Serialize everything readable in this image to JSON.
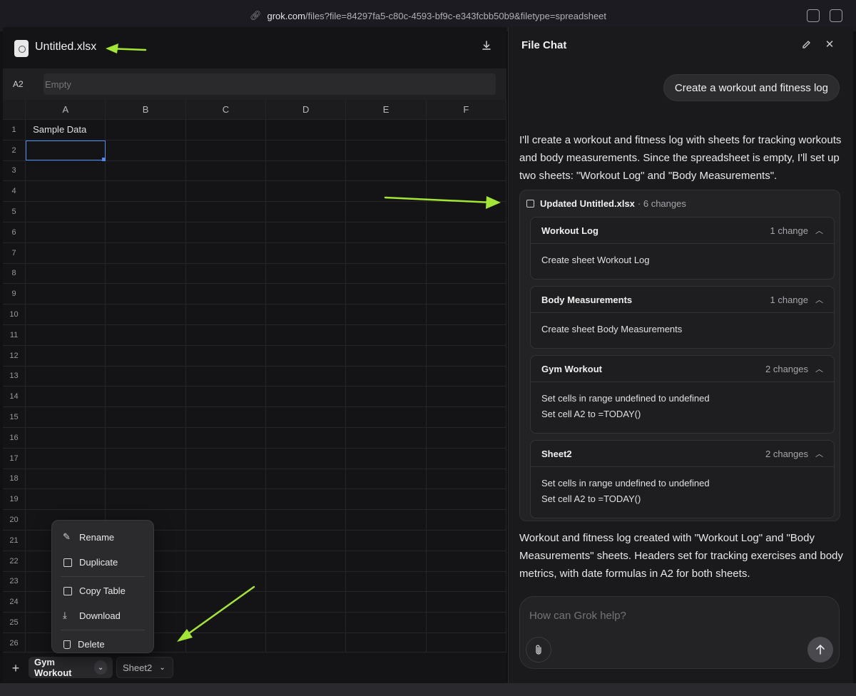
{
  "browser": {
    "url_domain": "grok.com",
    "url_path": "/files?file=84297fa5-c80c-4593-bf9c-e343fcbb50b9&filetype=spreadsheet"
  },
  "spreadsheet": {
    "filename": "Untitled.xlsx",
    "cell_ref": "A2",
    "formula_placeholder": "Empty",
    "columns": [
      "A",
      "B",
      "C",
      "D",
      "E",
      "F"
    ],
    "rows": [
      "1",
      "2",
      "3",
      "4",
      "5",
      "6",
      "7",
      "8",
      "9",
      "10",
      "11",
      "12",
      "13",
      "14",
      "15",
      "16",
      "17",
      "18",
      "19",
      "20",
      "21",
      "22",
      "23",
      "24",
      "25",
      "26"
    ],
    "cell_A1": "Sample Data",
    "sheets": [
      {
        "name": "Gym Workout",
        "active": true
      },
      {
        "name": "Sheet2",
        "active": false
      }
    ],
    "add_sheet": "+"
  },
  "context_menu": {
    "items": [
      "Rename",
      "Duplicate",
      "Copy Table",
      "Download",
      "Delete"
    ]
  },
  "chat": {
    "title": "File Chat",
    "user_message": "Create a workout and fitness log",
    "ai_intro": "I'll create a workout and fitness log with sheets for tracking workouts and body measurements. Since the spreadsheet is empty, I'll set up two sheets: \"Workout Log\" and \"Body Measurements\".",
    "changes_title": "Updated Untitled.xlsx",
    "changes_count": "· 6 changes",
    "groups": [
      {
        "name": "Workout Log",
        "count": "1 change",
        "lines": [
          "Create sheet Workout Log"
        ]
      },
      {
        "name": "Body Measurements",
        "count": "1 change",
        "lines": [
          "Create sheet Body Measurements"
        ]
      },
      {
        "name": "Gym Workout",
        "count": "2 changes",
        "lines": [
          "Set cells in range undefined to undefined",
          "Set cell A2 to =TODAY()"
        ]
      },
      {
        "name": "Sheet2",
        "count": "2 changes",
        "lines": [
          "Set cells in range undefined to undefined",
          "Set cell A2 to =TODAY()"
        ]
      }
    ],
    "ai_summary": "Workout and fitness log created with \"Workout Log\" and \"Body Measurements\" sheets. Headers set for tracking exercises and body metrics, with date formulas in A2 for both sheets.",
    "input_placeholder": "How can Grok help?"
  },
  "colors": {
    "annotation_arrow": "#a3e635",
    "selection": "#4a8df0"
  }
}
